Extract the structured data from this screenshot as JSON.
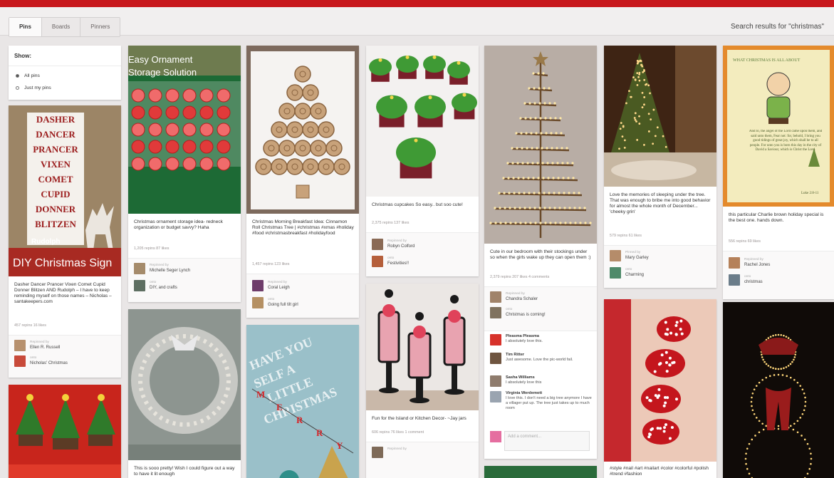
{
  "tabs": [
    "Pins",
    "Boards",
    "Pinners"
  ],
  "search_caption": "Search results for \"christmas\"",
  "show": {
    "title": "Show:",
    "options": [
      "All pins",
      "Just my pins"
    ],
    "selected": "All pins"
  },
  "pins": [
    {
      "desc": "Dasher Dancer Prancer Vixen Comet Cupid Donner Blitzen AND Rudolph – I have to keep reminding myself on those names – Nicholas – santakeepers.com",
      "stats": "457 repins   16 likes",
      "repinned_by_label": "Repinned by",
      "user": "Ellen R. Russell",
      "onto_label": "onto",
      "board": "Nicholas' Christmas",
      "sign_words": [
        "DASHER",
        "DANCER",
        "PRANCER",
        "VIXEN",
        "COMET",
        "CUPID",
        "DONNER",
        "BLITZEN"
      ],
      "sign_caption": "DIY Christmas Sign",
      "sign_brand": "Rudolph"
    },
    {
      "overlay": "Easy Ornament Storage Solution",
      "desc": "Christmas ornament storage idea- redneck organization or budget savvy? Haha",
      "stats": "1,205 repins   87 likes",
      "repinned_by_label": "Repinned by",
      "user": "Michelle Seger Lynch",
      "onto_label": "onto",
      "board": "DIY, and crafts"
    },
    {
      "desc": "Christmas Morning Breakfast Idea: Cinnamon Roll Christmas Tree | #christmas #xmas #holiday #food #christmasbreakfast #holidayfood",
      "stats": "1,457 repins   123 likes",
      "repinned_by_label": "Repinned by",
      "user": "Coral Leigh",
      "onto_label": "onto",
      "board": "Going full tilt girl"
    },
    {
      "desc": "Christmas cupcakes So easy.. but soo cute!",
      "stats": "2,375 repins   137 likes",
      "repinned_by_label": "Repinned by",
      "user": "Robyn Colford",
      "onto_label": "onto",
      "board": "Festivities!!"
    },
    {
      "desc": "Cute in our bedroom with their stockings under so when the girls wake up they can open them :)",
      "stats": "2,379 repins   207 likes   4 comments",
      "repinned_by_label": "Repinned by",
      "user": "Chandra Schaler",
      "onto_label": "onto",
      "board": "Christmas is coming!",
      "comments": [
        {
          "name": "Pleasma Pleasma",
          "text": "I absolutely love this."
        },
        {
          "name": "Tim Ritter",
          "text": "Just awesome. Love the pic-world fail."
        },
        {
          "name": "Sasha Williams",
          "text": "I absolutely love this"
        },
        {
          "name": "Virginia Werdemott",
          "text": "I love this. I don't need a big tree anymore I have a villager put up. The tree just takes up to much room"
        }
      ],
      "add_comment_placeholder": "Add a comment..."
    },
    {
      "desc": "Love the memories of sleeping under the tree. That was enough to bribe me into good behavior for almost the whole month of December... 'cheeky grin'",
      "stats": "579 repins   61 likes",
      "repinned_by_label": "Pinned by",
      "user": "Mary Garley",
      "onto_label": "onto",
      "board": "Charming"
    },
    {
      "card_title": "WHAT CHRISTMAS IS ALL ABOUT",
      "card_text": "And lo, the angel of the Lord came upon them, and said unto them, Fear not: for, behold, I bring you good tidings of great joy, which shall be to all people. For unto you is born this day in the city of David a Saviour, which is Christ the Lord.",
      "card_ref": "Luke 2:8-11",
      "desc": "this particular Charlie brown holiday special is the best one. hands down.",
      "stats": "556 repins   69 likes",
      "repinned_by_label": "Repinned by",
      "user": "Rachel Jones",
      "onto_label": "onto",
      "board": "christmas"
    },
    {
      "desc": "Fun for the Island or Kitchen Decor- ~Jay jars",
      "stats": "606 repins   76 likes   1 comment",
      "repinned_by_label": "Repinned by",
      "user": "",
      "onto_label": "",
      "board": ""
    },
    {
      "desc": "This is sooo pretty! Wish I could figure out a way to have it lit enough",
      "stats": "",
      "repinned_by_label": "",
      "user": "",
      "onto_label": "",
      "board": ""
    },
    {
      "desc": "#style #nail #art #nailart #color #colorful #polish #trend #fashion",
      "stats": "",
      "repinned_by_label": "",
      "user": "",
      "onto_label": "",
      "board": ""
    },
    {
      "merry_letters": [
        "M",
        "E",
        "R",
        "R",
        "Y"
      ],
      "sign_text": "HAVE YOURSELF A LITTLE CHRISTMAS"
    }
  ],
  "colors": {
    "accent_red": "#c8171c",
    "frame_bg": "#e9e6e6"
  }
}
